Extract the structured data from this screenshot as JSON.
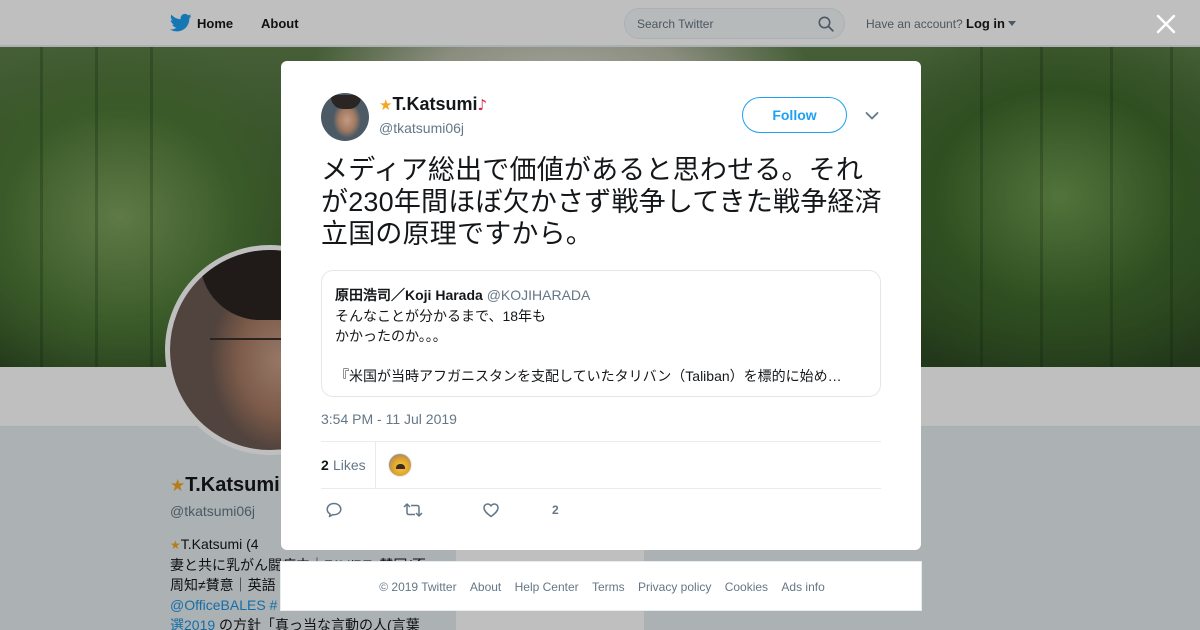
{
  "nav": {
    "home_label": "Home",
    "about_label": "About",
    "search_placeholder": "Search Twitter",
    "have_account": "Have an account?",
    "login_label": "Log in",
    "brand_color": "#1da1f2",
    "icons": [
      "twitter-bird-icon",
      "search-icon",
      "caret-down-icon"
    ]
  },
  "profile": {
    "name": "T.Katsumi",
    "handle": "@tkatsumi06j",
    "bio_line1": "T.Katsumi (4",
    "bio_line2": "妻と共に乳がん闘病中｜FAV/RT≠賛同(否",
    "bio_line3": "周知≠賛意｜英語",
    "bio_line4": "@OfficeBALES #",
    "bio_line5_link": "選2019",
    "bio_line5_rest": " の方針「真っ当な言動の人(言葉"
  },
  "tweet": {
    "author_name": "T.Katsumi",
    "author_handle": "@tkatsumi06j",
    "follow_label": "Follow",
    "text": "メディア総出で価値があると思わせる。それが230年間ほぼ欠かさず戦争してきた戦争経済立国の原理ですから。",
    "quote": {
      "name": "原田浩司／Koji Harada",
      "handle": "@KOJIHARADA",
      "text": "そんなことが分かるまで、18年も\nかかったのか。。。",
      "text2": "『米国が当時アフガニスタンを支配していたタリバン（Taliban）を標的に始め…"
    },
    "timestamp": "3:54 PM - 11 Jul 2019",
    "likes_count": "2",
    "likes_label": "Likes",
    "action_like_count": "2",
    "icons": [
      "reply-icon",
      "retweet-icon",
      "heart-icon",
      "chevron-down-icon",
      "close-icon"
    ]
  },
  "footer": {
    "links": [
      "© 2019 Twitter",
      "About",
      "Help Center",
      "Terms",
      "Privacy policy",
      "Cookies",
      "Ads info"
    ]
  }
}
